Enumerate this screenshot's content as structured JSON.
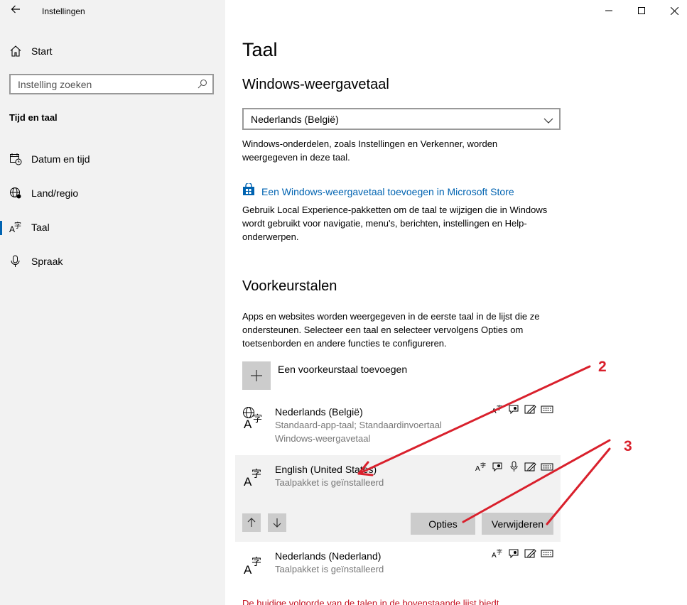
{
  "window": {
    "title": "Instellingen",
    "back_icon": "back-arrow-icon",
    "controls": [
      "minimize",
      "maximize",
      "close"
    ]
  },
  "sidebar": {
    "home_label": "Start",
    "search_placeholder": "Instelling zoeken",
    "section_title": "Tijd en taal",
    "items": [
      {
        "label": "Datum en tijd",
        "icon": "calendar-clock-icon"
      },
      {
        "label": "Land/regio",
        "icon": "globe-region-icon"
      },
      {
        "label": "Taal",
        "icon": "language-icon",
        "active": true
      },
      {
        "label": "Spraak",
        "icon": "microphone-icon"
      }
    ]
  },
  "main": {
    "title": "Taal",
    "display_language": {
      "heading": "Windows-weergavetaal",
      "selected": "Nederlands (België)",
      "description": "Windows-onderdelen, zoals Instellingen en Verkenner, worden weergegeven in deze taal.",
      "store_link": "Een Windows-weergavetaal toevoegen in Microsoft Store",
      "store_description": "Gebruik Local Experience-pakketten om de taal te wijzigen die in Windows wordt gebruikt voor navigatie, menu's, berichten, instellingen en Help-onderwerpen."
    },
    "preferred": {
      "heading": "Voorkeurstalen",
      "description": "Apps en websites worden weergegeven in de eerste taal in de lijst die ze ondersteunen. Selecteer een taal en selecteer vervolgens Opties om toetsenborden en andere functies te configureren.",
      "add_label": "Een voorkeurstaal toevoegen",
      "languages": [
        {
          "name": "Nederlands (België)",
          "sub1": "Standaard-app-taal; Standaardinvoertaal",
          "sub2": "Windows-weergavetaal"
        },
        {
          "name": "English (United States)",
          "sub1": "Taalpakket is geïnstalleerd",
          "selected": true
        },
        {
          "name": "Nederlands (Nederland)",
          "sub1": "Taalpakket is geïnstalleerd"
        }
      ],
      "options_button": "Opties",
      "remove_button": "Verwijderen"
    },
    "warning": "De huidige volgorde van de talen in de bovenstaande lijst biedt"
  },
  "annotations": {
    "label_2": "2",
    "label_3": "3",
    "color": "#d9202c"
  },
  "colors": {
    "accent": "#0063b1",
    "sidebar_bg": "#f2f2f2",
    "button_bg": "#cccccc",
    "warning": "#c50f1f"
  }
}
